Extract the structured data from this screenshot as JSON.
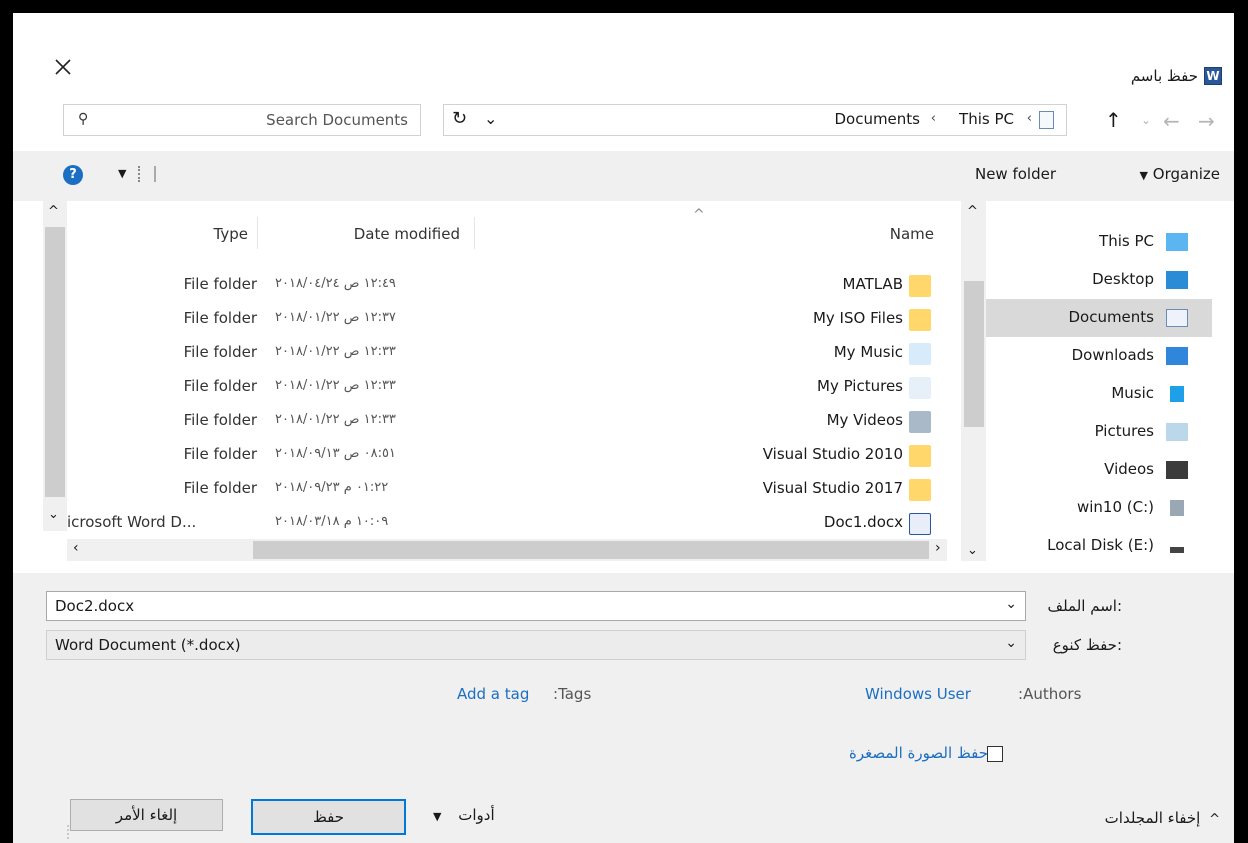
{
  "window": {
    "title": "حفظ باسم",
    "app_icon": "word-icon",
    "close_icon": "close-icon"
  },
  "address": {
    "path": [
      "This PC",
      "Documents"
    ],
    "separators": [
      "‹",
      "‹"
    ]
  },
  "search": {
    "placeholder": "Search Documents"
  },
  "toolbar": {
    "organize": "Organize",
    "new_folder": "New folder"
  },
  "columns": {
    "name": "Name",
    "date_modified": "Date modified",
    "type": "Type"
  },
  "files": [
    {
      "name": "MATLAB",
      "date": "١٢:٤٩ ص ٢٠١٨/٠٤/٢٤",
      "type": "File folder",
      "icon": "folder-icon"
    },
    {
      "name": "My ISO Files",
      "date": "١٢:٣٧ ص ٢٠١٨/٠١/٢٢",
      "type": "File folder",
      "icon": "folder-icon"
    },
    {
      "name": "My Music",
      "date": "١٢:٣٣ ص ٢٠١٨/٠١/٢٢",
      "type": "File folder",
      "icon": "music-folder-icon"
    },
    {
      "name": "My Pictures",
      "date": "١٢:٣٣ ص ٢٠١٨/٠١/٢٢",
      "type": "File folder",
      "icon": "pictures-folder-icon"
    },
    {
      "name": "My Videos",
      "date": "١٢:٣٣ ص ٢٠١٨/٠١/٢٢",
      "type": "File folder",
      "icon": "videos-folder-icon"
    },
    {
      "name": "Visual Studio 2010",
      "date": "٠٨:٥١ ص ٢٠١٨/٠٩/١٣",
      "type": "File folder",
      "icon": "folder-icon"
    },
    {
      "name": "Visual Studio 2017",
      "date": "٠١:٢٢ م ٢٠١٨/٠٩/٢٣",
      "type": "File folder",
      "icon": "folder-icon"
    },
    {
      "name": "Doc1.docx",
      "date": "١٠:٠٩ م ٢٠١٨/٠٣/١٨",
      "type": "icrosoft Word D...",
      "icon": "word-doc-icon"
    }
  ],
  "nav": [
    {
      "label": "This PC",
      "icon": "computer-icon"
    },
    {
      "label": "Desktop",
      "icon": "desktop-icon"
    },
    {
      "label": "Documents",
      "icon": "documents-icon",
      "selected": true
    },
    {
      "label": "Downloads",
      "icon": "download-icon"
    },
    {
      "label": "Music",
      "icon": "music-icon"
    },
    {
      "label": "Pictures",
      "icon": "pictures-icon"
    },
    {
      "label": "Videos",
      "icon": "videos-icon"
    },
    {
      "label": "win10 (C:)",
      "icon": "drive-icon"
    },
    {
      "label": "Local Disk (E:)",
      "icon": "disk-icon"
    }
  ],
  "form": {
    "filename_label": "اسم الملف:",
    "filename_value": "Doc2.docx",
    "savetype_label": "حفظ كنوع:",
    "savetype_value": "Word Document (*.docx)",
    "authors_label": "Authors:",
    "authors_value": "Windows User",
    "tags_label": "Tags:",
    "tags_value": "Add a tag",
    "thumbnail_label": "حفظ الصورة المصغرة",
    "thumbnail_checked": false
  },
  "footer": {
    "hide_folders": "إخفاء المجلدات",
    "tools": "أدوات",
    "save": "حفظ",
    "cancel": "إلغاء الأمر"
  },
  "colors": {
    "accent": "#0078d7",
    "link": "#1b6fc2",
    "selection": "#d9d9d9"
  }
}
